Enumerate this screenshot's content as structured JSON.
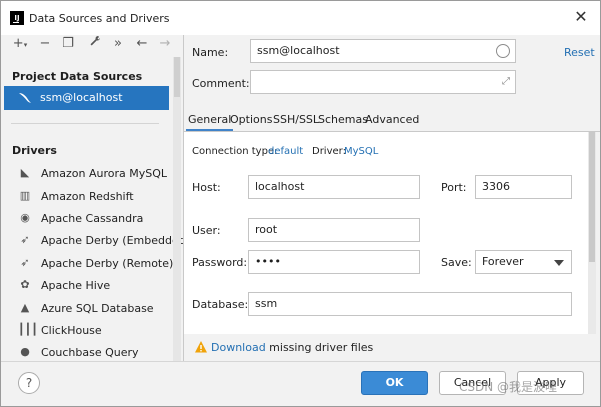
{
  "window": {
    "title": "Data Sources and Drivers"
  },
  "toolbar": {
    "add": "+",
    "add_arrow": "▾",
    "remove": "−",
    "duplicate": "❐",
    "settings": "🔧",
    "more": "»",
    "back": "←",
    "forward": "→"
  },
  "left": {
    "project_section": "Project Data Sources",
    "data_source": "ssm@localhost",
    "drivers_section": "Drivers",
    "drivers": [
      {
        "label": "Amazon Aurora MySQL",
        "icon": "aurora-icon"
      },
      {
        "label": "Amazon Redshift",
        "icon": "redshift-icon"
      },
      {
        "label": "Apache Cassandra",
        "icon": "cassandra-icon"
      },
      {
        "label": "Apache Derby (Embedded)",
        "icon": "derby-icon"
      },
      {
        "label": "Apache Derby (Remote)",
        "icon": "derby-icon"
      },
      {
        "label": "Apache Hive",
        "icon": "hive-icon"
      },
      {
        "label": "Azure SQL Database",
        "icon": "azure-icon"
      },
      {
        "label": "ClickHouse",
        "icon": "clickhouse-icon"
      },
      {
        "label": "Couchbase Query",
        "icon": "couchbase-icon"
      }
    ]
  },
  "form": {
    "name_label": "Name:",
    "name_value": "ssm@localhost",
    "reset": "Reset",
    "comment_label": "Comment:",
    "comment_value": ""
  },
  "tabs": [
    "General",
    "Options",
    "SSH/SSL",
    "Schemas",
    "Advanced"
  ],
  "general": {
    "connection_type_label": "Connection type:",
    "connection_type_value": "default",
    "driver_label": "Driver:",
    "driver_value": "MySQL",
    "host_label": "Host:",
    "host_value": "localhost",
    "port_label": "Port:",
    "port_value": "3306",
    "user_label": "User:",
    "user_value": "root",
    "password_label": "Password:",
    "password_value": "••••",
    "save_label": "Save:",
    "save_value": "Forever",
    "database_label": "Database:",
    "database_value": "ssm"
  },
  "warning": {
    "link": "Download",
    "text": " missing driver files"
  },
  "footer": {
    "help": "?",
    "ok": "OK",
    "cancel": "Cancel",
    "apply": "Apply",
    "watermark": "CSDN @我是波哩"
  },
  "colors": {
    "selection": "#2675bf",
    "link": "#2470b3",
    "ok_button": "#3b8bd6",
    "warning": "#f0a30a"
  }
}
